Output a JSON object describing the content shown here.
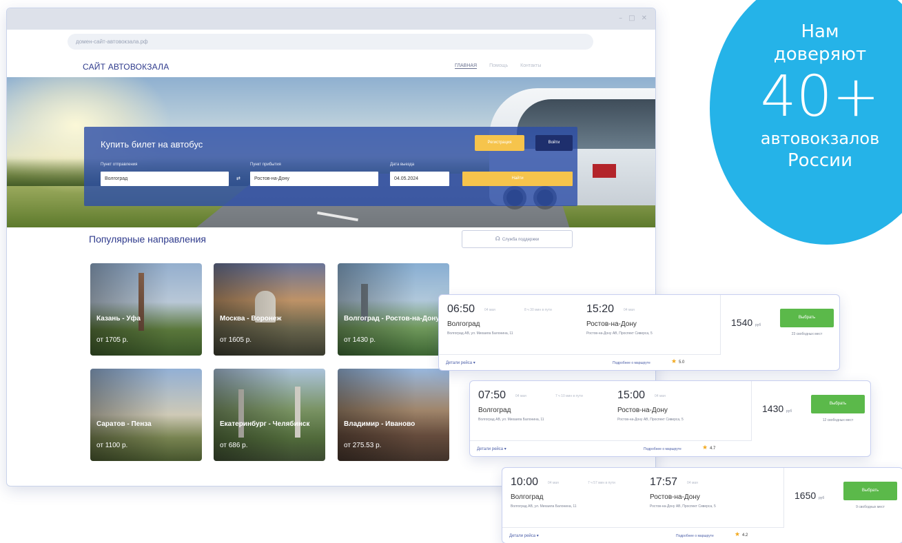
{
  "browser": {
    "url": "домен-сайт-автовокзала.рф",
    "controls": [
      "–",
      "□",
      "✕"
    ]
  },
  "site": {
    "logo": "САЙТ АВТОВОКЗАЛА",
    "nav": [
      "ГЛАВНАЯ",
      "Помощь",
      "Контакты"
    ]
  },
  "search": {
    "title": "Купить билет на автобус",
    "register_label": "Регистрация",
    "login_label": "Войти",
    "from_label": "Пункт отправления",
    "from_value": "Волгоград",
    "to_label": "Пункт прибытия",
    "to_value": "Ростов-на-Дону",
    "date_label": "Дата выезда",
    "date_value": "04.05.2024",
    "swap_icon": "⇄",
    "find_label": "Найти"
  },
  "popular": {
    "title": "Популярные направления",
    "support_label": "Служба поддержки",
    "support_icon": "headset-icon",
    "tiles": [
      {
        "name": "Казань - Уфа",
        "price": "от 1705 р."
      },
      {
        "name": "Москва - Воронеж",
        "price": "от 1605 р."
      },
      {
        "name": "Волгоград - Ростов-на-Дону",
        "price": "от 1430 р."
      },
      {
        "name": "Саратов - Пенза",
        "price": "от 1100 р."
      },
      {
        "name": "Екатеринбург - Челябинск",
        "price": "от 686 р."
      },
      {
        "name": "Владимир - Иваново",
        "price": "от 275.53 р."
      }
    ]
  },
  "trips": [
    {
      "depart_time": "06:50",
      "depart_date": "04 мая",
      "duration": "8 ч 30 мин в пути",
      "arrive_time": "15:20",
      "arrive_date": "04 мая",
      "from_city": "Волгоград",
      "from_addr": "Волгоград АВ, ул. Михаила Балонина, 11",
      "to_city": "Ростов-на-Дону",
      "to_addr": "Ростов-на-Дону АВ, Проспект Сиверса, 5",
      "price": "1540",
      "currency": "руб",
      "choose_label": "Выбрать",
      "seats": "23 свободных мест",
      "details_label": "Детали рейса",
      "about_label": "Подробнее о маршруте",
      "rating": "5.0"
    },
    {
      "depart_time": "07:50",
      "depart_date": "04 мая",
      "duration": "7 ч 10 мин в пути",
      "arrive_time": "15:00",
      "arrive_date": "04 мая",
      "from_city": "Волгоград",
      "from_addr": "Волгоград АВ, ул. Михаила Балонина, 11",
      "to_city": "Ростов-на-Дону",
      "to_addr": "Ростов-на-Дону АВ, Проспект Сиверса, 5",
      "price": "1430",
      "currency": "руб",
      "choose_label": "Выбрать",
      "seats": "12 свободных мест",
      "details_label": "Детали рейса",
      "about_label": "Подробнее о маршруте",
      "rating": "4.7"
    },
    {
      "depart_time": "10:00",
      "depart_date": "04 мая",
      "duration": "7 ч 57 мин в пути",
      "arrive_time": "17:57",
      "arrive_date": "04 мая",
      "from_city": "Волгоград",
      "from_addr": "Волгоград АВ, ул. Михаила Балонина, 11",
      "to_city": "Ростов-на-Дону",
      "to_addr": "Ростов-на-Дону АВ, Проспект Сиверса, 5",
      "price": "1650",
      "currency": "руб",
      "choose_label": "Выбрать",
      "seats": "9 свободных мест",
      "details_label": "Детали рейса",
      "about_label": "Подробнее о маршруте",
      "rating": "4.2"
    }
  ],
  "badge": {
    "line1": "Нам",
    "line2": "доверяют",
    "number": "40+",
    "line3": "автовокзалов",
    "line4": "России",
    "color": "#25b3e8"
  }
}
